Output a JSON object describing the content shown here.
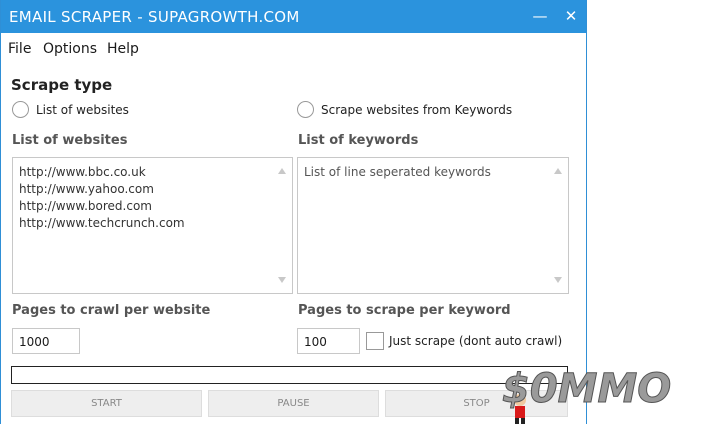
{
  "window": {
    "title": "EMAIL SCRAPER - SUPAGROWTH.COM",
    "minimize": "—",
    "close": "✕"
  },
  "menu": {
    "file": "File",
    "options": "Options",
    "help": "Help"
  },
  "scrape_type": {
    "heading": "Scrape type",
    "option_websites": "List of websites",
    "option_keywords": "Scrape websites from Keywords"
  },
  "websites": {
    "label": "List of websites",
    "lines": [
      "http://www.bbc.co.uk",
      "http://www.yahoo.com",
      "http://www.bored.com",
      "http://www.techcrunch.com"
    ]
  },
  "keywords": {
    "label": "List of keywords",
    "placeholder": "List of line seperated keywords"
  },
  "pages_website": {
    "label": "Pages to crawl per website",
    "value": "1000"
  },
  "pages_keyword": {
    "label": "Pages to scrape per keyword",
    "value": "100",
    "just_scrape": "Just scrape (dont auto crawl)"
  },
  "actions": {
    "start": "START",
    "pause": "PAUSE",
    "stop": "STOP"
  },
  "watermark": {
    "text": "$0MMO"
  },
  "colors": {
    "titlebar": "#2b93dd",
    "watermark_red": "#d91a1a"
  }
}
